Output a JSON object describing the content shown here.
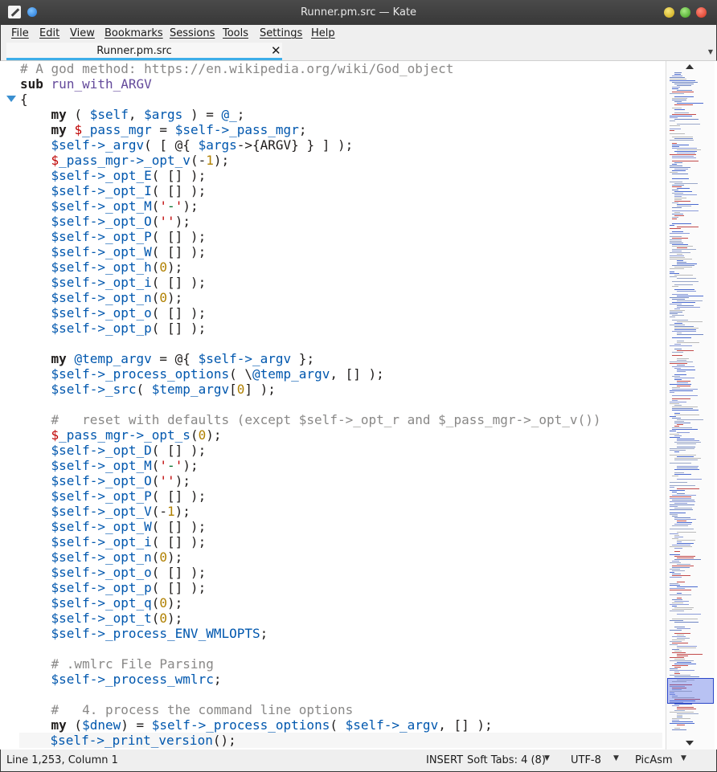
{
  "window": {
    "title": "Runner.pm.src — Kate"
  },
  "menu": [
    "File",
    "Edit",
    "View",
    "Bookmarks",
    "Sessions",
    "Tools",
    "Settings",
    "Help"
  ],
  "tab": {
    "label": "Runner.pm.src"
  },
  "status": {
    "position": "Line 1,253, Column 1",
    "mode": "INSERT",
    "indent": "Soft Tabs: 4 (8)",
    "encoding": "UTF-8",
    "syntax": "PicAsm"
  },
  "code_lines": [
    "# A god method: https://en.wikipedia.org/wiki/God_object",
    "sub run_with_ARGV",
    "{",
    "    my ( $self, $args ) = @_;",
    "    my $_pass_mgr = $self->_pass_mgr;",
    "    $self->_argv( [ @{ $args->{ARGV} } ] );",
    "    $_pass_mgr->_opt_v(-1);",
    "    $self->_opt_E( [] );",
    "    $self->_opt_I( [] );",
    "    $self->_opt_M('-');",
    "    $self->_opt_O('');",
    "    $self->_opt_P( [] );",
    "    $self->_opt_W( [] );",
    "    $self->_opt_h(0);",
    "    $self->_opt_i( [] );",
    "    $self->_opt_n(0);",
    "    $self->_opt_o( [] );",
    "    $self->_opt_p( [] );",
    "",
    "    my @temp_argv = @{ $self->_argv };",
    "    $self->_process_options( \\@temp_argv, [] );",
    "    $self->_src( $temp_argv[0] );",
    "",
    "    #   reset with defaults (except $self->_opt_r and $_pass_mgr->_opt_v())",
    "    $_pass_mgr->_opt_s(0);",
    "    $self->_opt_D( [] );",
    "    $self->_opt_M('-');",
    "    $self->_opt_O('');",
    "    $self->_opt_P( [] );",
    "    $self->_opt_V(-1);",
    "    $self->_opt_W( [] );",
    "    $self->_opt_i( [] );",
    "    $self->_opt_n(0);",
    "    $self->_opt_o( [] );",
    "    $self->_opt_p( [] );",
    "    $self->_opt_q(0);",
    "    $self->_opt_t(0);",
    "    $self->_process_ENV_WMLOPTS;",
    "",
    "    # .wmlrc File Parsing",
    "    $self->_process_wmlrc;",
    "",
    "    #   4. process the command line options",
    "    my ($dnew) = $self->_process_options( $self->_argv, [] );",
    "    $self->_print_version();"
  ],
  "colors": {
    "comment": "#898887",
    "variable": "#0057ae",
    "special_variable": "#bf0303",
    "number": "#b08000",
    "function_name": "#644a9b",
    "accent": "#3daee9",
    "minimap_viewport": "#2b46c8"
  },
  "icons": {
    "app": "kate-edit-icon",
    "pin": "pin-icon",
    "tab_close": "close-icon",
    "fold": "fold-triangle-icon"
  }
}
